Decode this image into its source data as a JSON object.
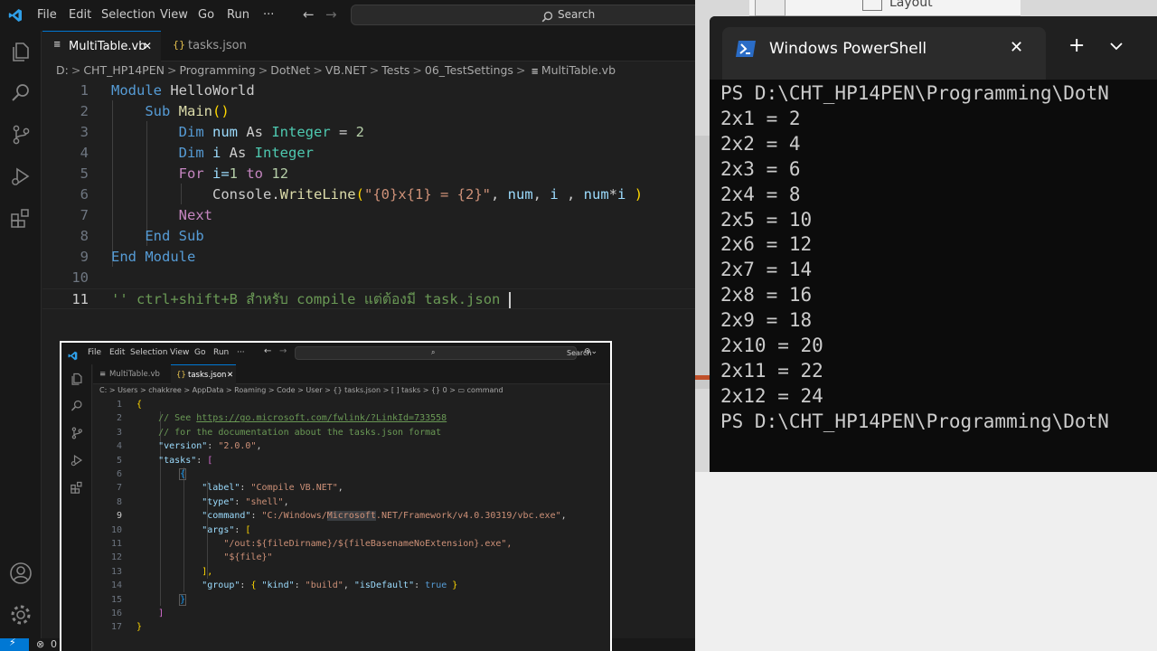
{
  "menu": {
    "file": "File",
    "edit": "Edit",
    "selection": "Selection",
    "view": "View",
    "go": "Go",
    "run": "Run",
    "more": "···"
  },
  "search": {
    "label": "Search"
  },
  "tabs": [
    {
      "label": "MultiTable.vb",
      "close": "✕"
    },
    {
      "label": "tasks.json"
    }
  ],
  "breadcrumb": [
    "D:",
    "CHT_HP14PEN",
    "Programming",
    "DotNet",
    "VB.NET",
    "Tests",
    "06_TestSettings",
    "MultiTable.vb"
  ],
  "editor": {
    "line_numbers": [
      "1",
      "2",
      "3",
      "4",
      "5",
      "6",
      "7",
      "8",
      "9",
      "10",
      "11"
    ],
    "lines": {
      "l1": {
        "a": "Module",
        "b": " HelloWorld"
      },
      "l2": {
        "a": "Sub",
        "b": " ",
        "c": "Main",
        "d": "(",
        "e": ")"
      },
      "l3": {
        "a": "Dim",
        "b": " num ",
        "c": "As",
        "d": " ",
        "e": "Integer",
        "f": " = ",
        "g": "2"
      },
      "l4": {
        "a": "Dim",
        "b": " i ",
        "c": "As",
        "d": " ",
        "e": "Integer"
      },
      "l5": {
        "a": "For",
        "b": " i=",
        "c": "1",
        "d": " ",
        "e": "to",
        "f": " ",
        "g": "12"
      },
      "l6": {
        "a": "Console",
        "b": ".",
        "c": "WriteLine",
        "d": "(",
        "e": "\"{0}x{1} = {2}\"",
        "f": ", ",
        "g": "num",
        "h": ", ",
        "i": "i",
        "j": " , ",
        "k": "num",
        "l": "*",
        "m": "i",
        "n": " )"
      },
      "l7": {
        "a": "Next"
      },
      "l8": {
        "a": "End",
        "b": " ",
        "c": "Sub"
      },
      "l9": {
        "a": "End",
        "b": " ",
        "c": "Module"
      },
      "l11": {
        "a": "'' ctrl+shift+B สำหรับ compile แต่ต้องมี task.json "
      }
    }
  },
  "inner": {
    "menu": {
      "file": "File",
      "edit": "Edit",
      "selection": "Selection",
      "view": "View",
      "go": "Go",
      "run": "Run",
      "more": "···"
    },
    "search": "Search",
    "tabs": [
      {
        "label": "MultiTable.vb"
      },
      {
        "label": "tasks.json",
        "close": "✕"
      }
    ],
    "breadcrumb": "C: > Users > chakkree > AppData > Roaming > Code > User > {} tasks.json > [ ] tasks > {} 0 > ▭ command",
    "line_numbers": [
      "1",
      "2",
      "3",
      "4",
      "5",
      "6",
      "7",
      "8",
      "9",
      "10",
      "11",
      "12",
      "13",
      "14",
      "15",
      "16",
      "17"
    ],
    "lines": {
      "l1": "{",
      "l2a": "// See ",
      "l2b": "https://go.microsoft.com/fwlink/?LinkId=733558",
      "l3": "// for the documentation about the tasks.json format",
      "l4k": "\"version\"",
      "l4v": "\"2.0.0\"",
      "l5k": "\"tasks\"",
      "l5v": "[",
      "l6": "{",
      "l7k": "\"label\"",
      "l7v": "\"Compile VB.NET\"",
      "l8k": "\"type\"",
      "l8v": "\"shell\"",
      "l9k": "\"command\"",
      "l9v1": "\"C:/Windows/",
      "l9v2": "Microsoft",
      "l9v3": ".NET/Framework/v4.0.30319/vbc.exe\"",
      "l10k": "\"args\"",
      "l10v": "[",
      "l11": "\"/out:${fileDirname}/${fileBasenameNoExtension}.exe\",",
      "l12": "\"${file}\"",
      "l13": "],",
      "l14k": "\"group\"",
      "l14a": "{ ",
      "l14b": "\"kind\"",
      "l14c": ": ",
      "l14d": "\"build\"",
      "l14e": ", ",
      "l14f": "\"isDefault\"",
      "l14g": ": ",
      "l14h": "true",
      "l14i": " }",
      "l15": "}",
      "l16": "]",
      "l17": "}"
    }
  },
  "status": {
    "errors": "0"
  },
  "back_window": {
    "label": "Layout"
  },
  "powershell": {
    "title": "Windows PowerShell",
    "close": "✕",
    "new_tab": "+",
    "dropdown": "⌄",
    "output": [
      "PS D:\\CHT_HP14PEN\\Programming\\DotN",
      "2x1 = 2",
      "2x2 = 4",
      "2x3 = 6",
      "2x4 = 8",
      "2x5 = 10",
      "2x6 = 12",
      "2x7 = 14",
      "2x8 = 16",
      "2x9 = 18",
      "2x10 = 20",
      "2x11 = 22",
      "2x12 = 24",
      "PS D:\\CHT_HP14PEN\\Programming\\DotN"
    ]
  }
}
